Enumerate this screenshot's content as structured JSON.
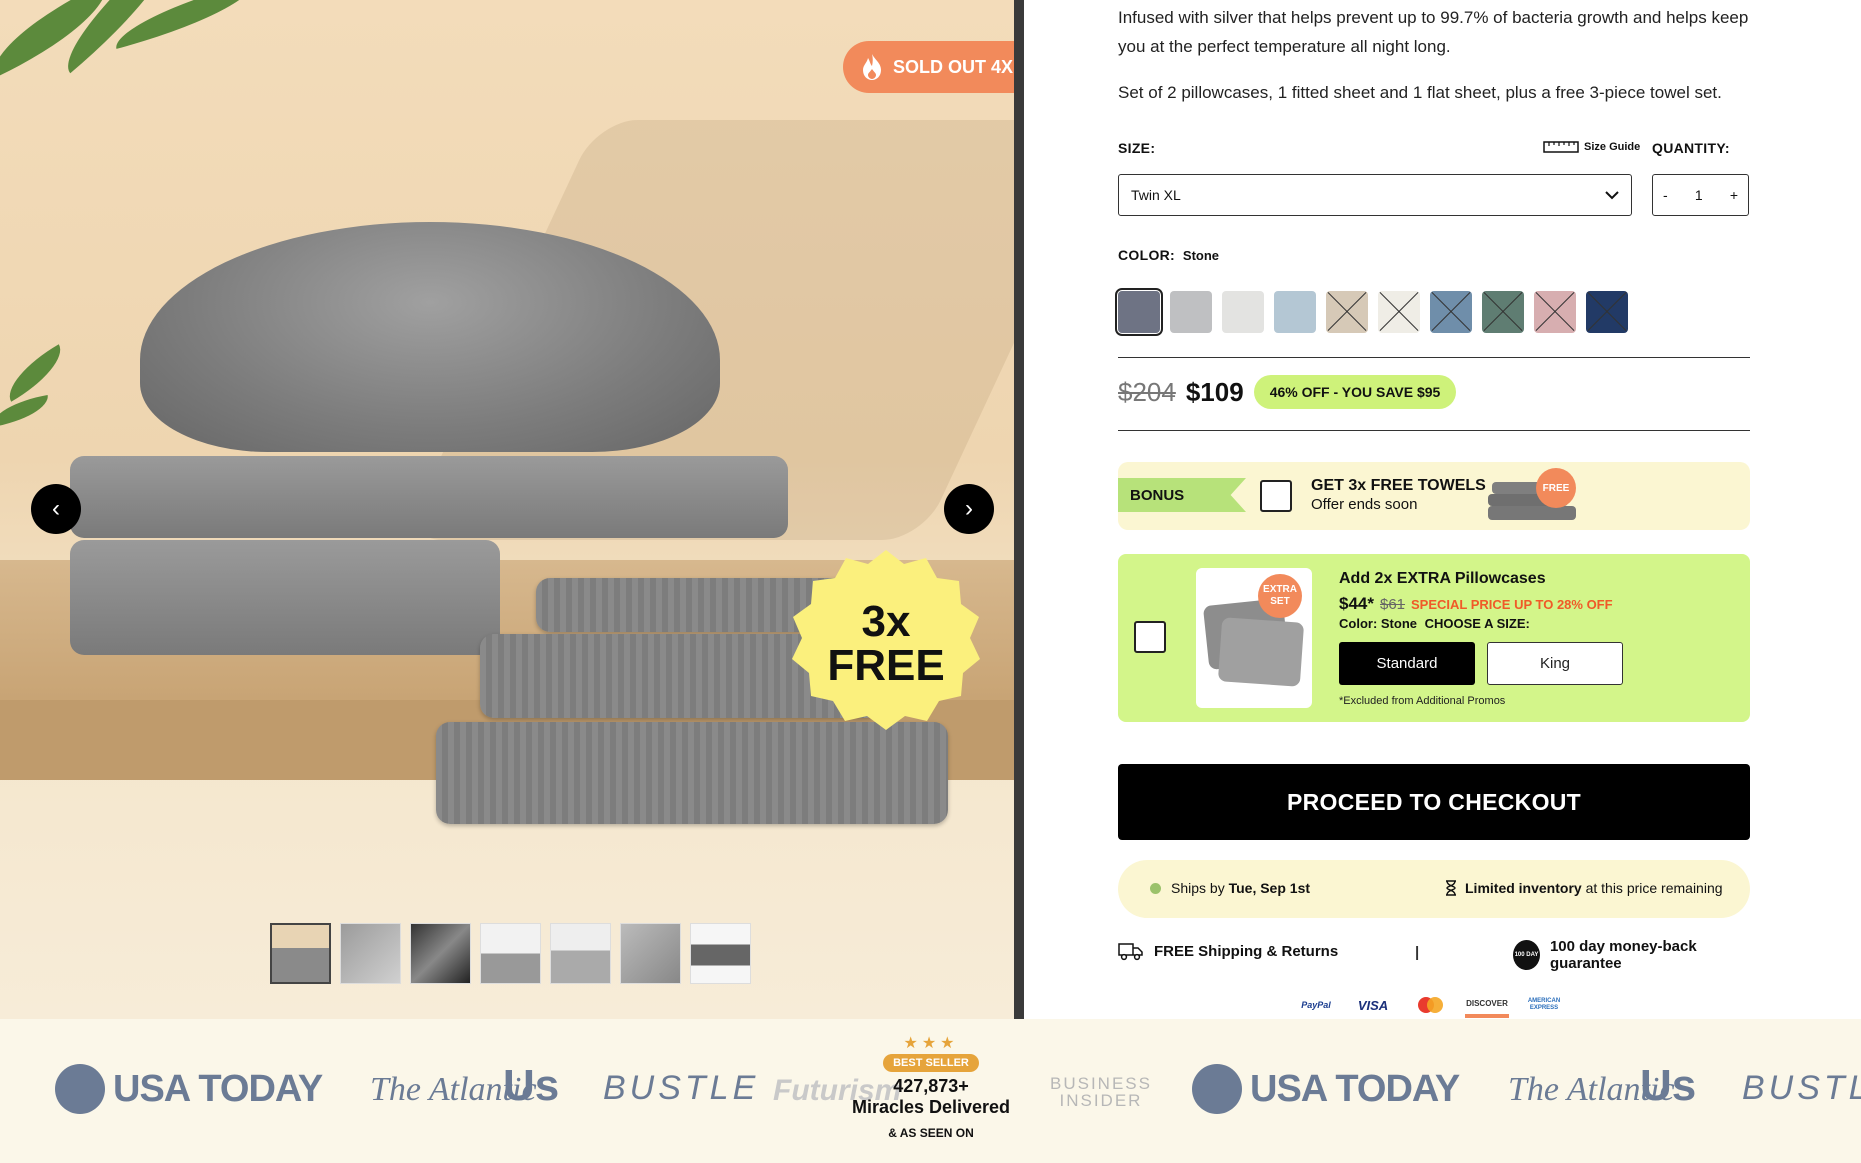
{
  "gallery": {
    "sold_badge": "SOLD OUT 4X",
    "free_badge_line1": "3x",
    "free_badge_line2": "FREE",
    "prev_arrow": "‹",
    "next_arrow": "›",
    "thumbnail_count": 7
  },
  "product": {
    "description": "Infused with silver that helps prevent up to 99.7% of bacteria growth and helps keep you at the perfect temperature all night long.",
    "set_info": "Set of 2 pillowcases, 1 fitted sheet and 1 flat sheet, plus a free 3-piece towel set.",
    "size_label": "SIZE:",
    "size_guide": "Size Guide",
    "quantity_label": "QUANTITY:",
    "size_value": "Twin XL",
    "qty_minus": "-",
    "qty_value": "1",
    "qty_plus": "+",
    "color_label": "COLOR:",
    "color_value": "Stone",
    "swatches": [
      {
        "color": "#6e7384",
        "selected": true,
        "available": true
      },
      {
        "color": "#bfc0c2",
        "selected": false,
        "available": true
      },
      {
        "color": "#e3e3e1",
        "selected": false,
        "available": true
      },
      {
        "color": "#b4c7d4",
        "selected": false,
        "available": true
      },
      {
        "color": "#d6c9b7",
        "selected": false,
        "available": false
      },
      {
        "color": "#efede6",
        "selected": false,
        "available": false
      },
      {
        "color": "#6f8eaa",
        "selected": false,
        "available": false
      },
      {
        "color": "#5f7d72",
        "selected": false,
        "available": false
      },
      {
        "color": "#d7aeb0",
        "selected": false,
        "available": false
      },
      {
        "color": "#223a66",
        "selected": false,
        "available": false
      }
    ],
    "old_price": "$204",
    "new_price": "$109",
    "save_text": "46% OFF - YOU SAVE $95"
  },
  "bonus": {
    "tag": "BONUS",
    "title": "GET 3x FREE TOWELS",
    "subtitle": "Offer ends soon",
    "free_sticker": "FREE"
  },
  "extra": {
    "sticker_line1": "EXTRA",
    "sticker_line2": "SET",
    "title": "Add 2x EXTRA Pillowcases",
    "price": "$44*",
    "old_price": "$61",
    "special": "SPECIAL PRICE UP TO 28% OFF",
    "color_line": "Color: Stone",
    "choose_size": "CHOOSE A SIZE:",
    "size_standard": "Standard",
    "size_king": "King",
    "note": "*Excluded from Additional Promos"
  },
  "checkout": {
    "button": "PROCEED TO CHECKOUT",
    "ships_prefix": "Ships by",
    "ships_date": "Tue, Sep 1st",
    "inventory_bold": "Limited inventory",
    "inventory_rest": "at this price remaining",
    "shipping": "FREE Shipping & Returns",
    "separator": "|",
    "guarantee": "100 day money-back guarantee",
    "guarantee_badge": "100 DAY",
    "payments": [
      "PayPal",
      "VISA",
      "Mastercard",
      "DISCOVER",
      "AMERICAN EXPRESS"
    ]
  },
  "press": {
    "usa_today": "USA TODAY",
    "atlantic": "The Atlantic",
    "us": "Us",
    "bustle": "BUSTLE",
    "futurism": "Futurism",
    "business_insider_1": "BUSINESS",
    "business_insider_2": "INSIDER",
    "stars": "★★★",
    "best_seller": "BEST SELLER",
    "miracles_count": "427,873+",
    "miracles_text": "Miracles Delivered",
    "as_seen_on": "& AS SEEN ON"
  }
}
